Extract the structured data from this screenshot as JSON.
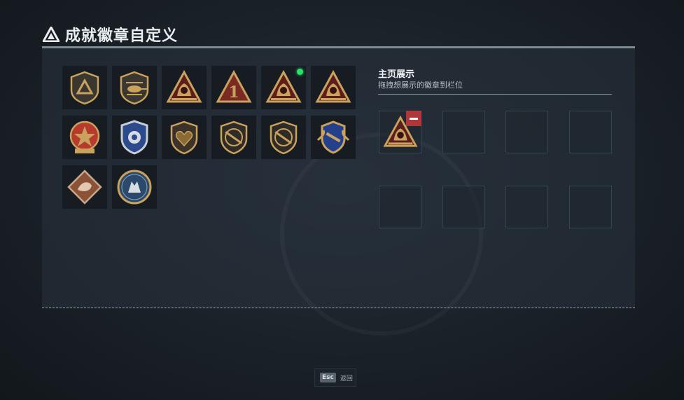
{
  "header": {
    "title": "成就徽章自定义",
    "icon": "delta-triangle-icon"
  },
  "badges": [
    {
      "name": "badge-triangle-shield",
      "shape": "shield",
      "row": 0,
      "col": 0
    },
    {
      "name": "badge-helicopter-shield",
      "shape": "shield-heli",
      "row": 0,
      "col": 1
    },
    {
      "name": "badge-triangle-bull",
      "shape": "tri-animal",
      "row": 0,
      "col": 2
    },
    {
      "name": "badge-triangle-one",
      "shape": "tri-one",
      "row": 0,
      "col": 3
    },
    {
      "name": "badge-triangle-lion",
      "shape": "tri-animal",
      "row": 0,
      "col": 4,
      "new": true
    },
    {
      "name": "badge-triangle-eagle",
      "shape": "tri-animal",
      "row": 0,
      "col": 5
    },
    {
      "name": "badge-red-star-medal",
      "shape": "medal-red",
      "row": 1,
      "col": 0
    },
    {
      "name": "badge-police-shield",
      "shape": "shield-blue",
      "row": 1,
      "col": 1
    },
    {
      "name": "badge-heart-shield",
      "shape": "shield-heart",
      "row": 1,
      "col": 2
    },
    {
      "name": "badge-rifle-shield-1",
      "shape": "shield-rifle",
      "row": 1,
      "col": 3
    },
    {
      "name": "badge-rifle-shield-2",
      "shape": "shield-rifle",
      "row": 1,
      "col": 4
    },
    {
      "name": "badge-winged-shield",
      "shape": "shield-wing",
      "row": 1,
      "col": 5
    },
    {
      "name": "badge-dragon-diamond",
      "shape": "diamond",
      "row": 2,
      "col": 0
    },
    {
      "name": "badge-wolf-circle",
      "shape": "circle",
      "row": 2,
      "col": 1
    }
  ],
  "showcase": {
    "title": "主页展示",
    "subtitle": "拖拽想展示的徽章到栏位",
    "slots": [
      {
        "filled": true,
        "shape": "tri-animal",
        "removable": true
      },
      {
        "filled": false
      },
      {
        "filled": false
      },
      {
        "filled": false
      },
      {
        "filled": false
      },
      {
        "filled": false
      },
      {
        "filled": false
      },
      {
        "filled": false
      }
    ]
  },
  "footer": {
    "key": "Esc",
    "label": "返回"
  },
  "colors": {
    "gold": "#c9a25e",
    "new_dot": "#29e06b",
    "remove": "#b0363a"
  }
}
